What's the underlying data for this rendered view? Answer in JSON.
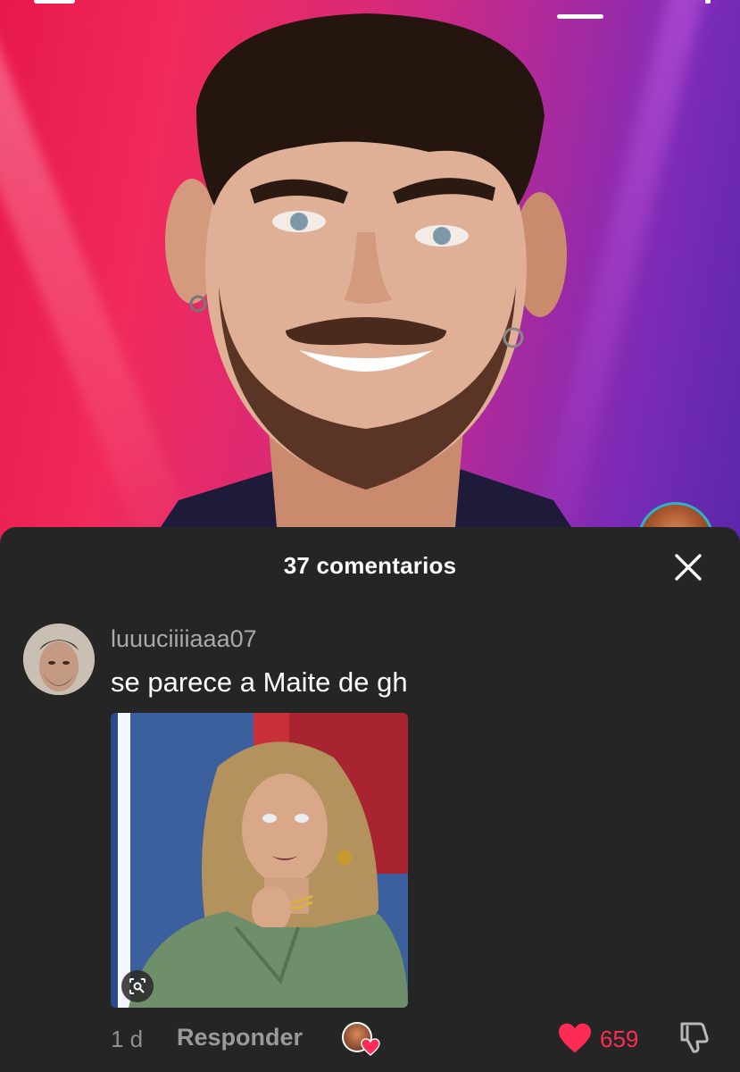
{
  "comments_sheet": {
    "title": "37 comentarios",
    "close_icon": "close-icon"
  },
  "comment": {
    "username": "luuuciiiiaaa07",
    "text": "se parece a Maite de gh",
    "timestamp": "1 d",
    "reply_label": "Responder",
    "like_count": "659",
    "liked": true
  },
  "colors": {
    "accent": "#fe2c55",
    "sheet_bg": "#252525",
    "username": "#a9a9a9",
    "creator_ring": "#2db1c4"
  },
  "icons": [
    "close-icon",
    "heart-icon",
    "dislike-icon",
    "lens-search-icon"
  ]
}
